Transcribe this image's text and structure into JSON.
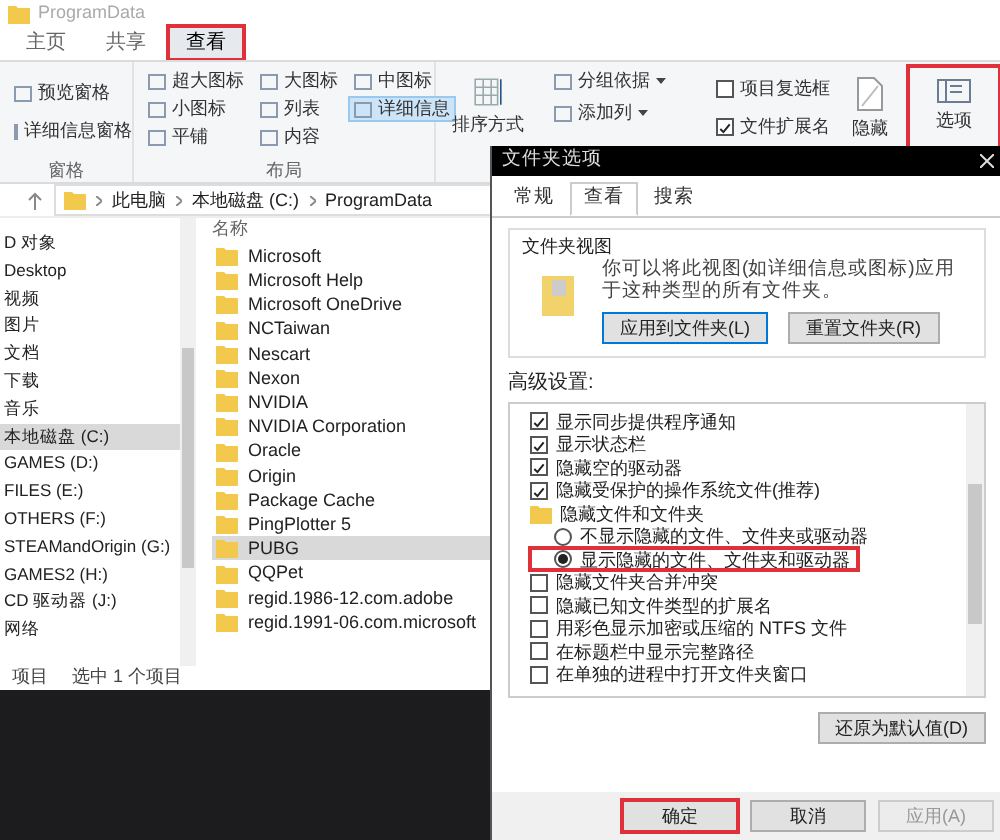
{
  "explorer": {
    "title": "ProgramData",
    "tabs": [
      {
        "label": "主页",
        "selected": false,
        "highlighted": false
      },
      {
        "label": "共享",
        "selected": false,
        "highlighted": false
      },
      {
        "label": "查看",
        "selected": true,
        "highlighted": true
      }
    ],
    "ribbon": {
      "pane_items": [
        "预览窗格",
        "详细信息窗格"
      ],
      "pane_group": "窗格",
      "layout_items": [
        {
          "label": "超大图标",
          "selected": false
        },
        {
          "label": "大图标",
          "selected": false
        },
        {
          "label": "中图标",
          "selected": false
        },
        {
          "label": "小图标",
          "selected": false
        },
        {
          "label": "列表",
          "selected": false
        },
        {
          "label": "详细信息",
          "selected": true
        },
        {
          "label": "平铺",
          "selected": false
        },
        {
          "label": "内容",
          "selected": false
        }
      ],
      "layout_group": "布局",
      "sort_button": "排序方式",
      "view_items": [
        "分组依据",
        "添加列"
      ],
      "checkboxes": [
        {
          "label": "项目复选框",
          "checked": false
        },
        {
          "label": "文件扩展名",
          "checked": true
        }
      ],
      "hide_button": "隐藏",
      "options_button": {
        "label": "选项",
        "highlighted": true
      }
    },
    "address": [
      "此电脑",
      "本地磁盘 (C:)",
      "ProgramData"
    ],
    "nav_items": [
      {
        "label": "D 对象",
        "selected": false
      },
      {
        "label": "Desktop",
        "selected": false
      },
      {
        "label": "视频",
        "selected": false
      },
      {
        "label": "图片",
        "selected": false
      },
      {
        "label": "文档",
        "selected": false
      },
      {
        "label": "下载",
        "selected": false
      },
      {
        "label": "音乐",
        "selected": false
      },
      {
        "label": "本地磁盘 (C:)",
        "selected": true
      },
      {
        "label": "GAMES (D:)",
        "selected": false
      },
      {
        "label": "FILES (E:)",
        "selected": false
      },
      {
        "label": "OTHERS (F:)",
        "selected": false
      },
      {
        "label": "STEAMandOrigin (G:)",
        "selected": false
      },
      {
        "label": "GAMES2 (H:)",
        "selected": false
      },
      {
        "label": "CD 驱动器 (J:)",
        "selected": false
      },
      {
        "label": "网络",
        "selected": false
      }
    ],
    "column_header": "名称",
    "files": [
      {
        "name": "Microsoft",
        "selected": false
      },
      {
        "name": "Microsoft Help",
        "selected": false
      },
      {
        "name": "Microsoft OneDrive",
        "selected": false
      },
      {
        "name": "NCTaiwan",
        "selected": false
      },
      {
        "name": "Nescart",
        "selected": false
      },
      {
        "name": "Nexon",
        "selected": false
      },
      {
        "name": "NVIDIA",
        "selected": false
      },
      {
        "name": "NVIDIA Corporation",
        "selected": false
      },
      {
        "name": "Oracle",
        "selected": false
      },
      {
        "name": "Origin",
        "selected": false
      },
      {
        "name": "Package Cache",
        "selected": false
      },
      {
        "name": "PingPlotter 5",
        "selected": false
      },
      {
        "name": "PUBG",
        "selected": true
      },
      {
        "name": "QQPet",
        "selected": false
      },
      {
        "name": "regid.1986-12.com.adobe",
        "selected": false
      },
      {
        "name": "regid.1991-06.com.microsoft",
        "selected": false
      }
    ],
    "status_bar": [
      "项目",
      "选中 1 个项目"
    ]
  },
  "dialog": {
    "title": "文件夹选项",
    "tabs": [
      {
        "label": "常规",
        "selected": false
      },
      {
        "label": "查看",
        "selected": true
      },
      {
        "label": "搜索",
        "selected": false
      }
    ],
    "folder_views": {
      "title": "文件夹视图",
      "text": "你可以将此视图(如详细信息或图标)应用于这种类型的所有文件夹。",
      "buttons": [
        "应用到文件夹(L)",
        "重置文件夹(R)"
      ]
    },
    "advanced_label": "高级设置:",
    "settings": [
      {
        "kind": "checkbox",
        "label": "显示同步提供程序通知",
        "checked": true
      },
      {
        "kind": "checkbox",
        "label": "显示状态栏",
        "checked": true
      },
      {
        "kind": "checkbox",
        "label": "隐藏空的驱动器",
        "checked": true
      },
      {
        "kind": "checkbox",
        "label": "隐藏受保护的操作系统文件(推荐)",
        "checked": true
      },
      {
        "kind": "folder",
        "label": "隐藏文件和文件夹",
        "children": [
          {
            "kind": "radio",
            "label": "不显示隐藏的文件、文件夹或驱动器",
            "selected": false,
            "highlighted": false
          },
          {
            "kind": "radio",
            "label": "显示隐藏的文件、文件夹和驱动器",
            "selected": true,
            "highlighted": true
          }
        ]
      },
      {
        "kind": "checkbox",
        "label": "隐藏文件夹合并冲突",
        "checked": false
      },
      {
        "kind": "checkbox",
        "label": "隐藏已知文件类型的扩展名",
        "checked": false
      },
      {
        "kind": "checkbox",
        "label": "用彩色显示加密或压缩的 NTFS 文件",
        "checked": false
      },
      {
        "kind": "checkbox",
        "label": "在标题栏中显示完整路径",
        "checked": false
      },
      {
        "kind": "checkbox",
        "label": "在单独的进程中打开文件夹窗口",
        "checked": false
      }
    ],
    "restore_button": "还原为默认值(D)",
    "buttons": [
      {
        "label": "确定",
        "disabled": false,
        "highlighted": true
      },
      {
        "label": "取消",
        "disabled": false,
        "highlighted": false
      },
      {
        "label": "应用(A)",
        "disabled": true,
        "highlighted": false
      }
    ]
  }
}
